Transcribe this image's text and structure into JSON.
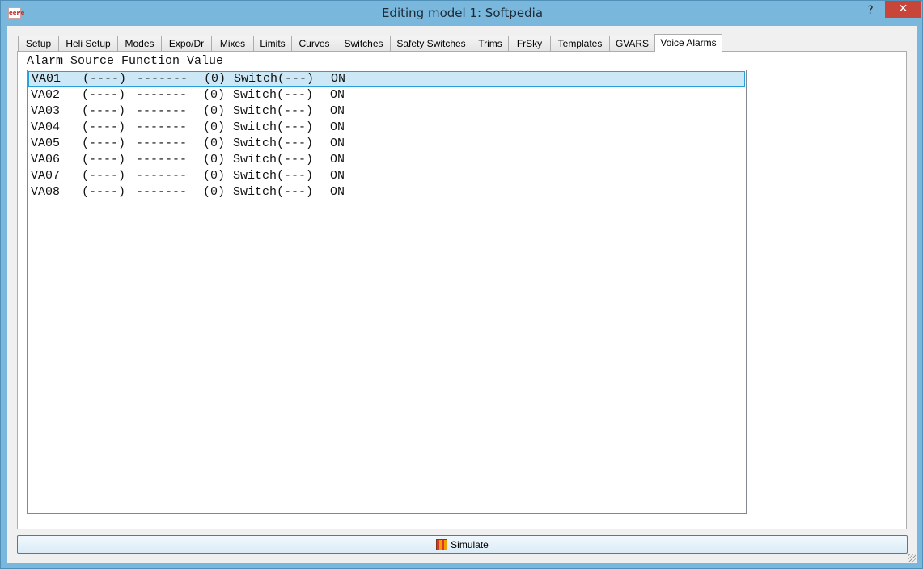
{
  "window": {
    "title": "Editing model 1: Softpedia",
    "app_icon": "eepe-icon",
    "help_label": "?",
    "close_label": "✕"
  },
  "tabs": [
    {
      "label": "Setup"
    },
    {
      "label": "Heli Setup"
    },
    {
      "label": "Modes"
    },
    {
      "label": "Expo/Dr"
    },
    {
      "label": "Mixes"
    },
    {
      "label": "Limits"
    },
    {
      "label": "Curves"
    },
    {
      "label": "Switches"
    },
    {
      "label": "Safety Switches"
    },
    {
      "label": "Trims"
    },
    {
      "label": "FrSky"
    },
    {
      "label": "Templates"
    },
    {
      "label": "GVARS"
    },
    {
      "label": "Voice Alarms"
    }
  ],
  "active_tab": "Voice Alarms",
  "alarm_list": {
    "headers": [
      "Alarm",
      "Source",
      "Function",
      "Value"
    ],
    "selected_index": 0,
    "rows": [
      {
        "alarm": "VA01",
        "source": "(----)",
        "function": "-------",
        "value": "(0)",
        "switch": "Switch(---)",
        "state": "ON"
      },
      {
        "alarm": "VA02",
        "source": "(----)",
        "function": "-------",
        "value": "(0)",
        "switch": "Switch(---)",
        "state": "ON"
      },
      {
        "alarm": "VA03",
        "source": "(----)",
        "function": "-------",
        "value": "(0)",
        "switch": "Switch(---)",
        "state": "ON"
      },
      {
        "alarm": "VA04",
        "source": "(----)",
        "function": "-------",
        "value": "(0)",
        "switch": "Switch(---)",
        "state": "ON"
      },
      {
        "alarm": "VA05",
        "source": "(----)",
        "function": "-------",
        "value": "(0)",
        "switch": "Switch(---)",
        "state": "ON"
      },
      {
        "alarm": "VA06",
        "source": "(----)",
        "function": "-------",
        "value": "(0)",
        "switch": "Switch(---)",
        "state": "ON"
      },
      {
        "alarm": "VA07",
        "source": "(----)",
        "function": "-------",
        "value": "(0)",
        "switch": "Switch(---)",
        "state": "ON"
      },
      {
        "alarm": "VA08",
        "source": "(----)",
        "function": "-------",
        "value": "(0)",
        "switch": "Switch(---)",
        "state": "ON"
      }
    ]
  },
  "simulate_button": {
    "label": "Simulate",
    "icon": "simulator-icon"
  },
  "colors": {
    "title_bar": "#79b7dd",
    "close_button": "#c8453a",
    "selection": "#cce8f6",
    "selection_border": "#26a0da"
  }
}
